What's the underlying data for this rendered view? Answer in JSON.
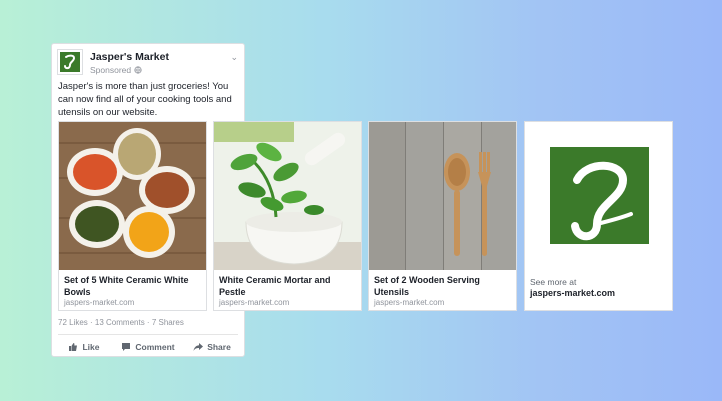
{
  "post": {
    "page_name": "Jasper's Market",
    "sponsored": "Sponsored",
    "sponsored_icon": "globe-icon",
    "text": "Jasper's is more than just groceries! You can now find all of your cooking tools and utensils on our website.",
    "social": "72 Likes · 13 Comments · 7 Shares",
    "actions": {
      "like": "Like",
      "comment": "Comment",
      "share": "Share"
    }
  },
  "cards": [
    {
      "title": "Set of 5 White Ceramic White Bowls",
      "domain": "jaspers-market.com"
    },
    {
      "title": "White Ceramic Mortar and Pestle",
      "domain": "jaspers-market.com"
    },
    {
      "title": "Set of 2 Wooden Serving Utensils",
      "domain": "jaspers-market.com"
    },
    {
      "see_more": "See more at",
      "domain": "jaspers-market.com"
    }
  ],
  "brand": {
    "logo_letter": "J",
    "logo_color": "#3b7a2a"
  }
}
